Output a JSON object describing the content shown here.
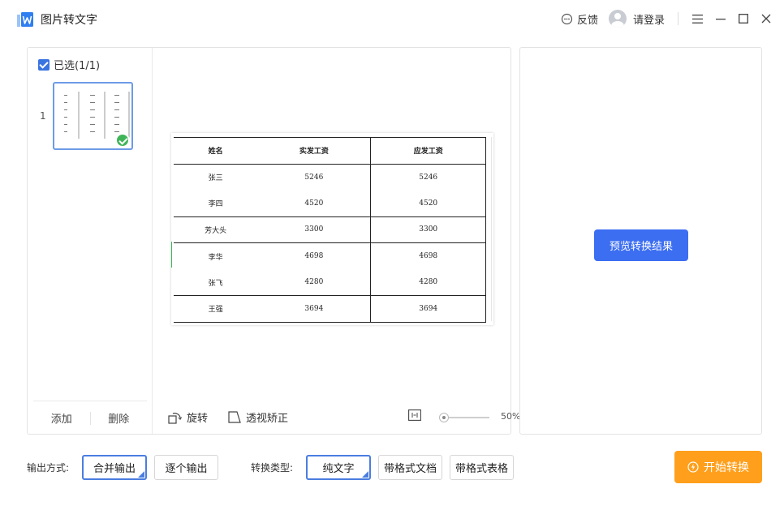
{
  "titlebar": {
    "app_title": "图片转文字",
    "feedback_label": "反馈",
    "login_label": "请登录"
  },
  "file_list": {
    "select_all_label": "已选(1/1)",
    "page_number": "1",
    "add_label": "添加",
    "delete_label": "删除"
  },
  "preview_table": {
    "headers": [
      "姓名",
      "实发工资",
      "应发工资"
    ],
    "rows": [
      [
        "张三",
        "5246",
        "5246"
      ],
      [
        "李四",
        "4520",
        "4520"
      ],
      [
        "芳大头",
        "3300",
        "3300"
      ],
      [
        "李华",
        "4698",
        "4698"
      ],
      [
        "张飞",
        "4280",
        "4280"
      ],
      [
        "王强",
        "3694",
        "3694"
      ]
    ]
  },
  "toolbar": {
    "rotate_label": "旋转",
    "perspective_label": "透视矫正",
    "zoom_percent": 50,
    "zoom_label": "50%"
  },
  "result_panel": {
    "preview_button_label": "预览转换结果"
  },
  "footer": {
    "output_mode_label": "输出方式:",
    "output_options": [
      "合并输出",
      "逐个输出"
    ],
    "output_selected": "合并输出",
    "convert_type_label": "转换类型:",
    "convert_options": [
      "纯文字",
      "带格式文档",
      "带格式表格"
    ],
    "convert_selected": "纯文字",
    "start_button_label": "开始转换"
  },
  "colors": {
    "accent_blue": "#3c6ef2",
    "start_orange": "#ff9f1c",
    "check_green": "#3fb558"
  }
}
